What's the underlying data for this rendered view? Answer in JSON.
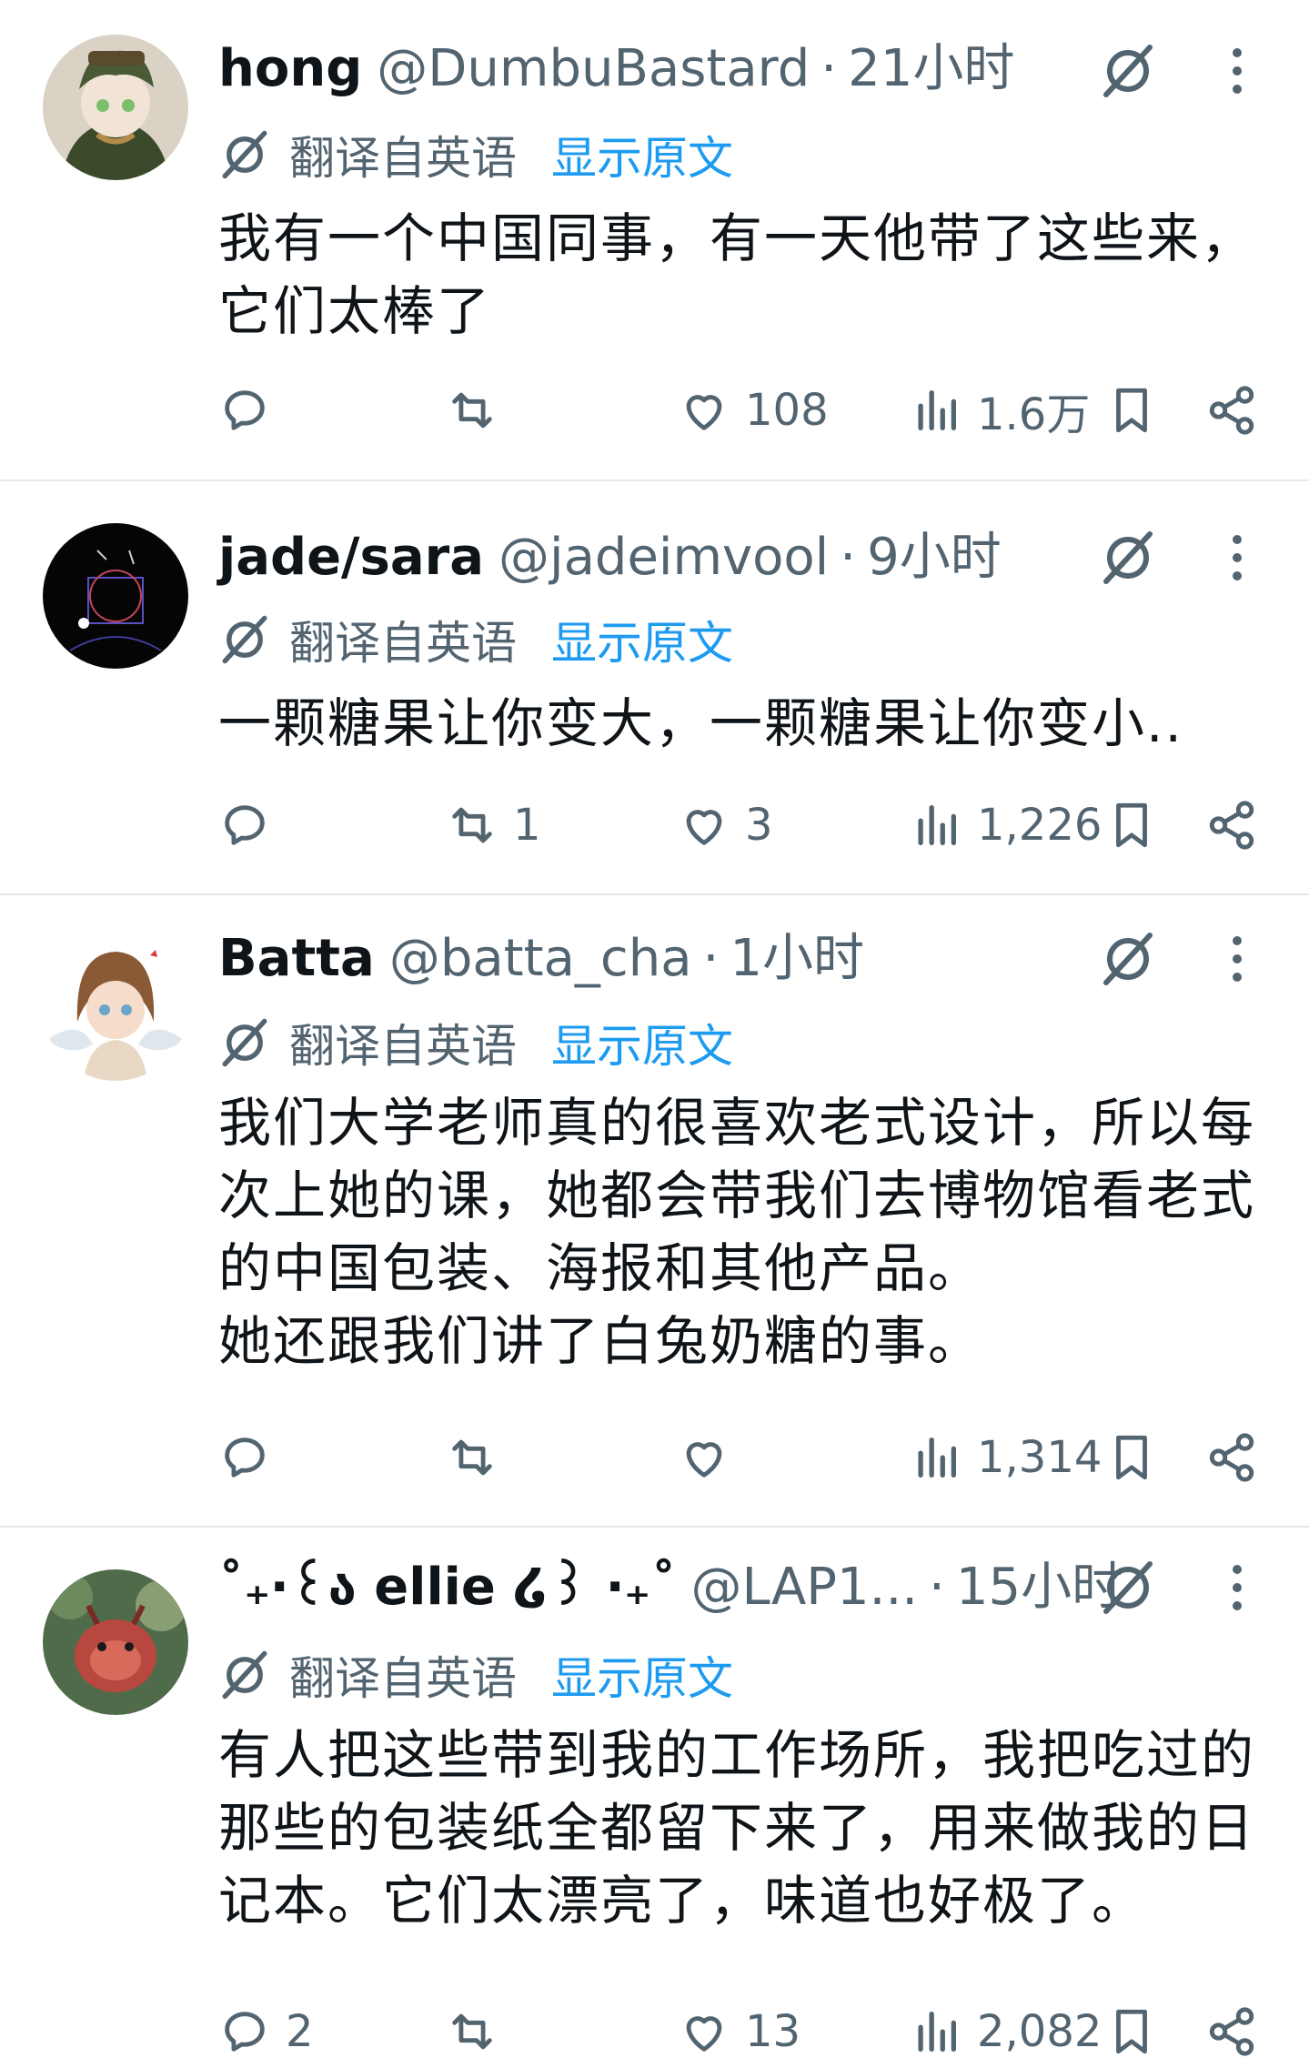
{
  "posts": [
    {
      "display_name": "hong",
      "handle": "@DumbuBastard",
      "separator": "·",
      "time": "21小时",
      "translated_label": "翻译自英语",
      "show_original": "显示原文",
      "text": "我有一个中国同事，有一天他带了这些来，\n它们太棒了",
      "replies": "",
      "reposts": "",
      "likes": "108",
      "views": "1.6万"
    },
    {
      "display_name": "jade/sara",
      "handle": "@jadeimvool",
      "separator": "·",
      "time": "9小时",
      "translated_label": "翻译自英语",
      "show_original": "显示原文",
      "text": "一颗糖果让你变大，一颗糖果让你变小..",
      "replies": "",
      "reposts": "1",
      "likes": "3",
      "views": "1,226"
    },
    {
      "display_name": "Batta",
      "handle": "@batta_cha",
      "separator": "·",
      "time": "1小时",
      "translated_label": "翻译自英语",
      "show_original": "显示原文",
      "text": "我们大学老师真的很喜欢老式设计，所以每\n次上她的课，她都会带我们去博物馆看老式\n的中国包装、海报和其他产品。\n她还跟我们讲了白兔奶糖的事。",
      "replies": "",
      "reposts": "",
      "likes": "",
      "views": "1,314"
    },
    {
      "display_name": "˚₊‧꒰ა ellie ໒꒱ ‧₊˚",
      "handle": "@LAP1...",
      "separator": "·",
      "time": "15小时",
      "translated_label": "翻译自英语",
      "show_original": "显示原文",
      "text": "有人把这些带到我的工作场所，我把吃过的\n那些的包装纸全都留下来了，用来做我的日\n记本。它们太漂亮了，味道也好极了。",
      "replies": "2",
      "reposts": "",
      "likes": "13",
      "views": "2,082"
    }
  ],
  "icons": {
    "reply": "reply-icon",
    "repost": "repost-icon",
    "like": "heart-icon",
    "views": "views-chart-icon",
    "bookmark": "bookmark-icon",
    "share": "share-icon",
    "grok": "grok-icon",
    "more": "more-vertical-icon",
    "translate": "translate-icon"
  },
  "colors": {
    "text": "#0f1419",
    "secondary": "#536471",
    "link": "#1d9bf0",
    "divider": "#e6e9ec"
  }
}
